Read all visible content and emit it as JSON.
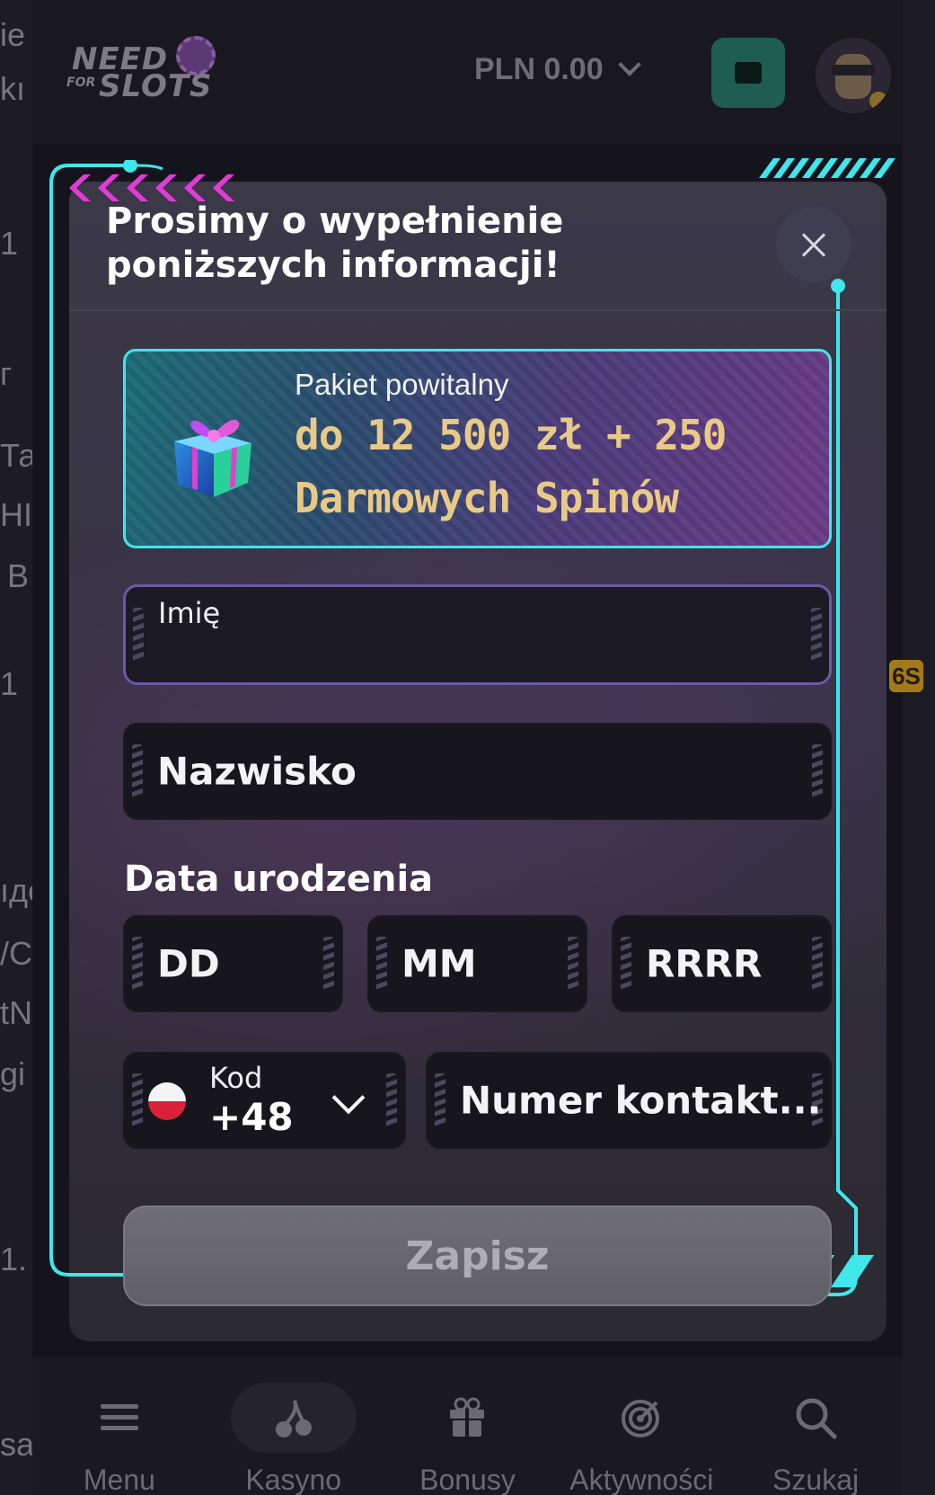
{
  "header": {
    "logo_text_need": "NEED",
    "logo_text_for": "FOR",
    "logo_text_slots": "SLOTS",
    "balance": "PLN 0.00",
    "wallet_icon": "wallet-icon",
    "avatar_icon": "user-avatar"
  },
  "background": {
    "left_fragments": [
      "ie",
      "kı",
      "1",
      "г",
      "Та",
      "НІ",
      "В",
      "1",
      "ıдо",
      "/С",
      "tN",
      "gi",
      "1.",
      "sa"
    ],
    "badge": "6S"
  },
  "modal": {
    "title": "Prosimy o wypełnienie poniższych informacji!",
    "close_icon": "close-icon",
    "promo": {
      "subtitle": "Pakiet powitalny",
      "line1": "do 12 500 zł + 250",
      "line2": "Darmowych Spinów",
      "icon": "gift-icon"
    },
    "fields": {
      "first_name_label": "Imię",
      "first_name_value": "",
      "last_name_placeholder": "Nazwisko",
      "dob_label": "Data urodzenia",
      "day_placeholder": "DD",
      "month_placeholder": "MM",
      "year_placeholder": "RRRR",
      "code_label": "Kod",
      "code_value": "+48",
      "phone_placeholder": "Numer kontakt..."
    },
    "save_label": "Zapisz"
  },
  "bottom_nav": {
    "items": [
      {
        "label": "Menu",
        "icon": "menu-icon"
      },
      {
        "label": "Kasyno",
        "icon": "cherry-icon"
      },
      {
        "label": "Bonusy",
        "icon": "gift-icon"
      },
      {
        "label": "Aktywności",
        "icon": "target-icon"
      },
      {
        "label": "Szukaj",
        "icon": "search-icon"
      }
    ],
    "active_index": 1
  },
  "colors": {
    "accent_cyan": "#3fe6ea",
    "accent_magenta": "#e23ad8",
    "promo_gold": "#e9c986",
    "field_focus": "#6b5aa3"
  }
}
